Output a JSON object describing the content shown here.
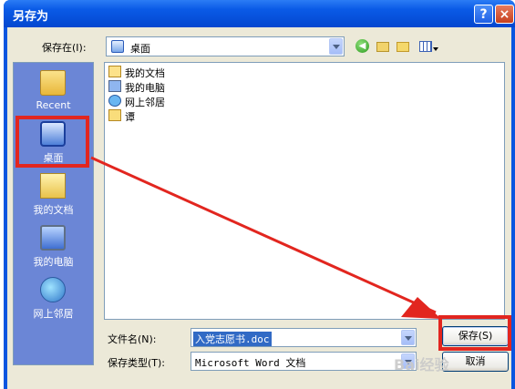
{
  "window": {
    "title": "另存为",
    "help_label": "?",
    "close_label": "×"
  },
  "top": {
    "save_in_label": "保存在(I):",
    "save_in_value": "桌面"
  },
  "places": [
    {
      "label": "Recent",
      "icon": "recent-folder-icon"
    },
    {
      "label": "桌面",
      "icon": "desktop-icon"
    },
    {
      "label": "我的文档",
      "icon": "my-documents-icon"
    },
    {
      "label": "我的电脑",
      "icon": "my-computer-icon"
    },
    {
      "label": "网上邻居",
      "icon": "network-places-icon"
    }
  ],
  "files": [
    {
      "name": "我的文档",
      "icon": "my-documents-icon"
    },
    {
      "name": "我的电脑",
      "icon": "my-computer-icon"
    },
    {
      "name": "网上邻居",
      "icon": "network-places-icon"
    },
    {
      "name": "谭",
      "icon": "folder-icon"
    }
  ],
  "filename": {
    "label": "文件名(N):",
    "value": "入党志愿书.doc"
  },
  "filetype": {
    "label": "保存类型(T):",
    "value": "Microsoft Word 文档"
  },
  "buttons": {
    "save": "保存(S)",
    "cancel": "取消"
  },
  "annotations": {
    "highlight_color": "#e2261f"
  },
  "watermark": "Bai经验"
}
